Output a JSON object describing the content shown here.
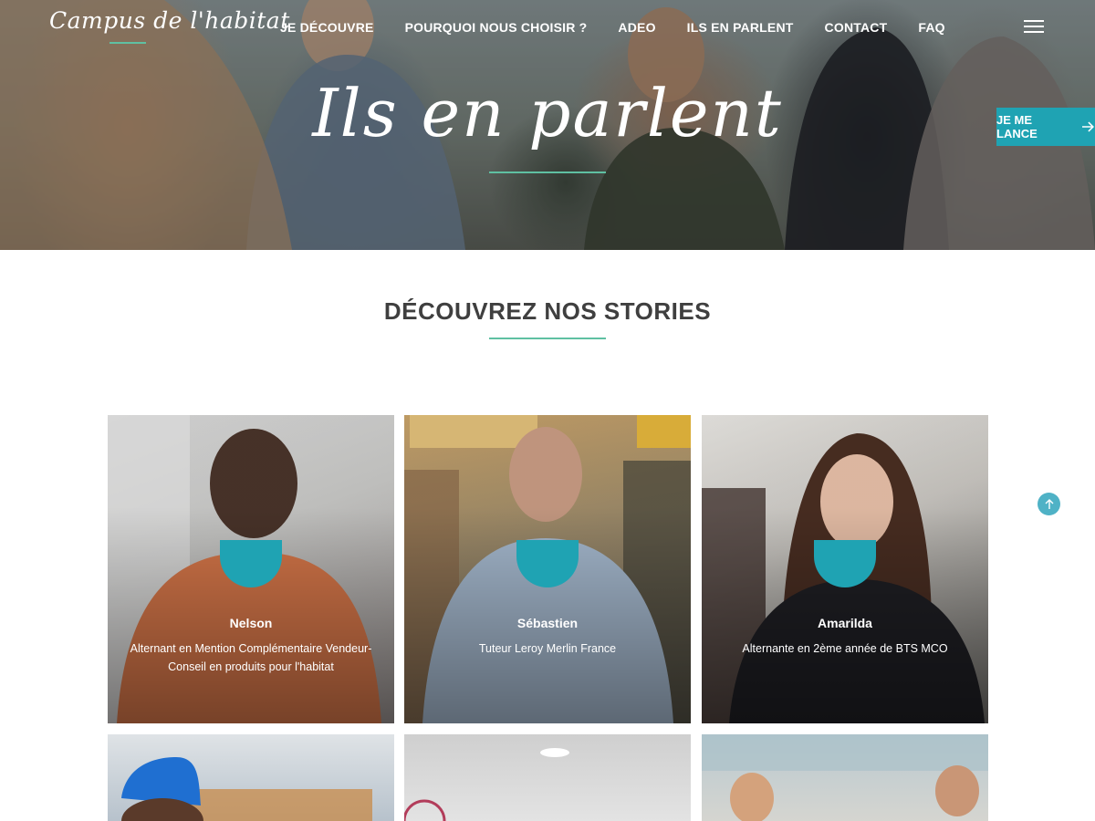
{
  "header": {
    "logo": "Campus de l'habitat",
    "nav": [
      "JE DÉCOUVRE",
      "POURQUOI NOUS CHOISIR ?",
      "ADEO",
      "ILS EN PARLENT",
      "CONTACT",
      "FAQ"
    ],
    "menu_icon": "hamburger-icon"
  },
  "hero": {
    "title": "Ils en parlent",
    "cta": "JE ME LANCE",
    "cta_icon": "arrow-right-icon"
  },
  "section": {
    "title": "DÉCOUVREZ NOS STORIES"
  },
  "stories": [
    {
      "name": "Nelson",
      "role": "Alternant en Mention Complémentaire Vendeur-Conseil en produits pour l'habitat"
    },
    {
      "name": "Sébastien",
      "role": "Tuteur Leroy Merlin France"
    },
    {
      "name": "Amarilda",
      "role": "Alternante en 2ème année de BTS MCO"
    }
  ],
  "colors": {
    "accent": "#1fa3b3",
    "underline": "#5fc0a2",
    "title_text": "#3f3f3f"
  },
  "scroll_top_icon": "arrow-up-icon"
}
